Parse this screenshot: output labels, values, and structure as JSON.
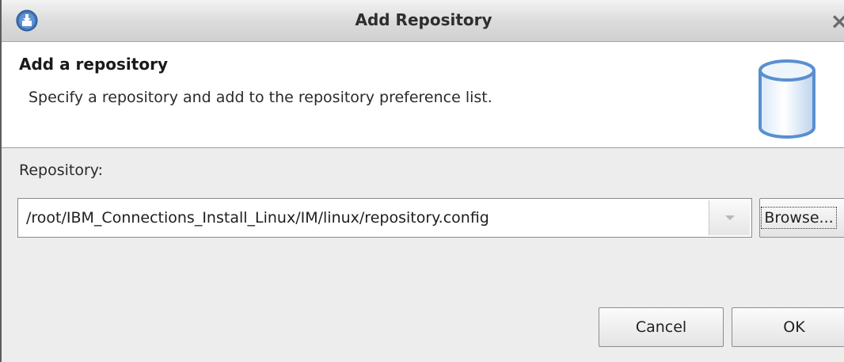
{
  "window": {
    "title": "Add Repository",
    "close_glyph": "×"
  },
  "banner": {
    "title": "Add a repository",
    "description": "Specify a repository and add to the repository preference list.",
    "icon": "repository-cylinder-icon"
  },
  "form": {
    "repository_label": "Repository:",
    "repository_value": "/root/IBM_Connections_Install_Linux/IM/linux/repository.config"
  },
  "buttons": {
    "browse_label": "Browse...",
    "cancel_label": "Cancel",
    "ok_label": "OK"
  },
  "colors": {
    "window_bg": "#ededed",
    "banner_bg": "#ffffff",
    "icon_blue": "#5a8fd0"
  }
}
